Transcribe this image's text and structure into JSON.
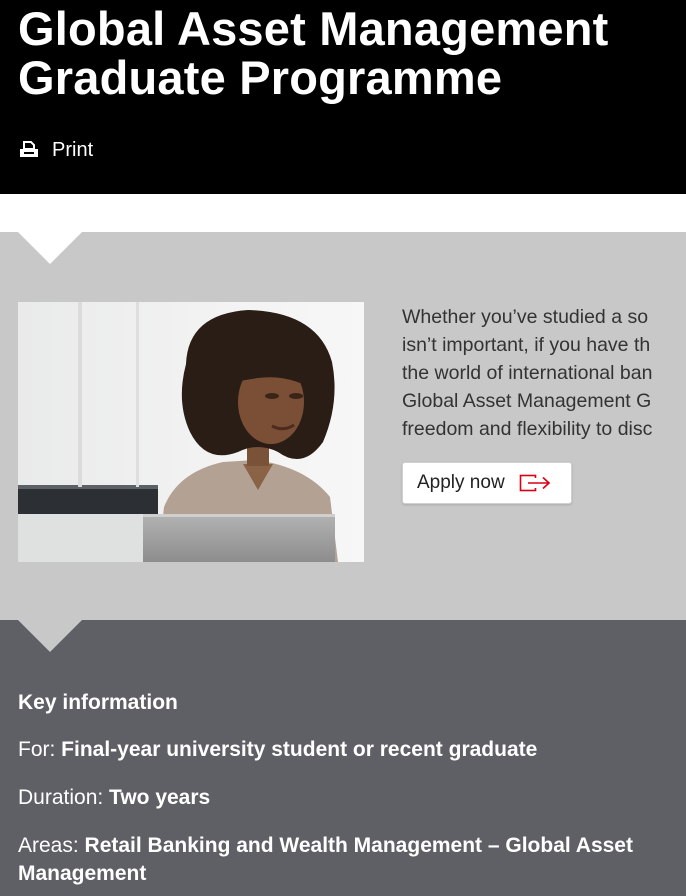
{
  "hero": {
    "title_line1": "Global Asset Management",
    "title_line2": "Graduate Programme",
    "print_label": "Print",
    "print_icon": "printer-icon"
  },
  "intro": {
    "image_alt": "Woman with curly hair sitting at a laptop",
    "text_lines": [
      "Whether you’ve studied a so",
      "isn’t important, if you have th",
      "the world of international ban",
      "Global Asset Management G",
      "freedom and flexibility to disc"
    ],
    "apply_label": "Apply now",
    "apply_icon": "external-link-icon"
  },
  "key_info": {
    "heading": "Key information",
    "for_label": "For: ",
    "for_value": "Final-year university student or recent graduate",
    "duration_label": "Duration: ",
    "duration_value": "Two years",
    "areas_label": "Areas: ",
    "areas_value": "Retail Banking and Wealth Management – Global Asset Management"
  },
  "colors": {
    "hero_bg": "#000000",
    "intro_bg": "#c8c8c8",
    "key_info_bg": "#5f6065",
    "accent_red": "#db0011"
  }
}
